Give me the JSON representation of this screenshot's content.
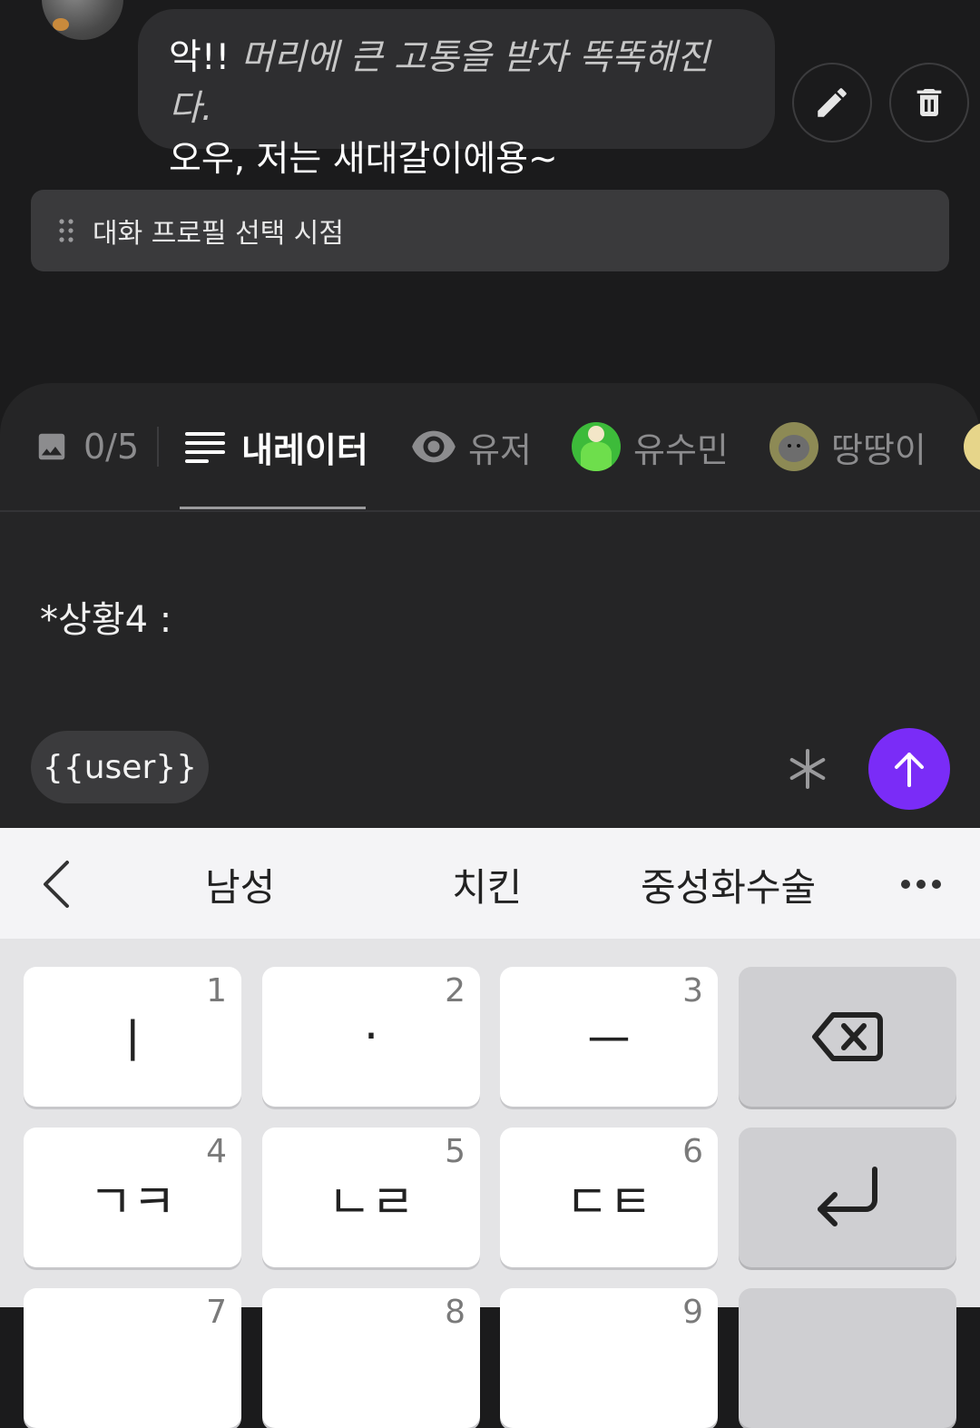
{
  "chat": {
    "message": {
      "line1_prefix": "악!! ",
      "line1_italic": "머리에 큰 고통을 받자 똑똑해진다.",
      "line2": "오우, 저는 새대갈이에용~"
    },
    "edit_icon": "pencil-icon",
    "delete_icon": "trash-icon"
  },
  "timing_bar": {
    "label": "대화 프로필 선택 시점",
    "icon": "drag-handle-icon"
  },
  "composer": {
    "tabs": {
      "images": {
        "icon": "image-icon",
        "label": "0/5"
      },
      "narrator": {
        "icon": "lines-icon",
        "label": "내레이터"
      },
      "user": {
        "icon": "eye-icon",
        "label": "유저"
      },
      "char1": {
        "label": "유수민"
      },
      "char2": {
        "label": "땅땅이"
      }
    },
    "input_text": "*상황4 :",
    "chip_label": "{{user}}",
    "colors": {
      "send": "#7a2cf7",
      "panel": "#252526"
    }
  },
  "keyboard": {
    "suggestions": [
      "남성",
      "치킨",
      "중성화수술"
    ],
    "back_icon": "chevron-left-icon",
    "more_icon": "more-horizontal-icon",
    "keys": [
      {
        "num": "1",
        "label": "ㅣ"
      },
      {
        "num": "2",
        "label": "·"
      },
      {
        "num": "3",
        "label": "ㅡ"
      },
      {
        "num": "4",
        "label": "ㄱㅋ"
      },
      {
        "num": "5",
        "label": "ㄴㄹ"
      },
      {
        "num": "6",
        "label": "ㄷㅌ"
      },
      {
        "num": "7",
        "label": ""
      },
      {
        "num": "8",
        "label": ""
      },
      {
        "num": "9",
        "label": ""
      }
    ]
  }
}
